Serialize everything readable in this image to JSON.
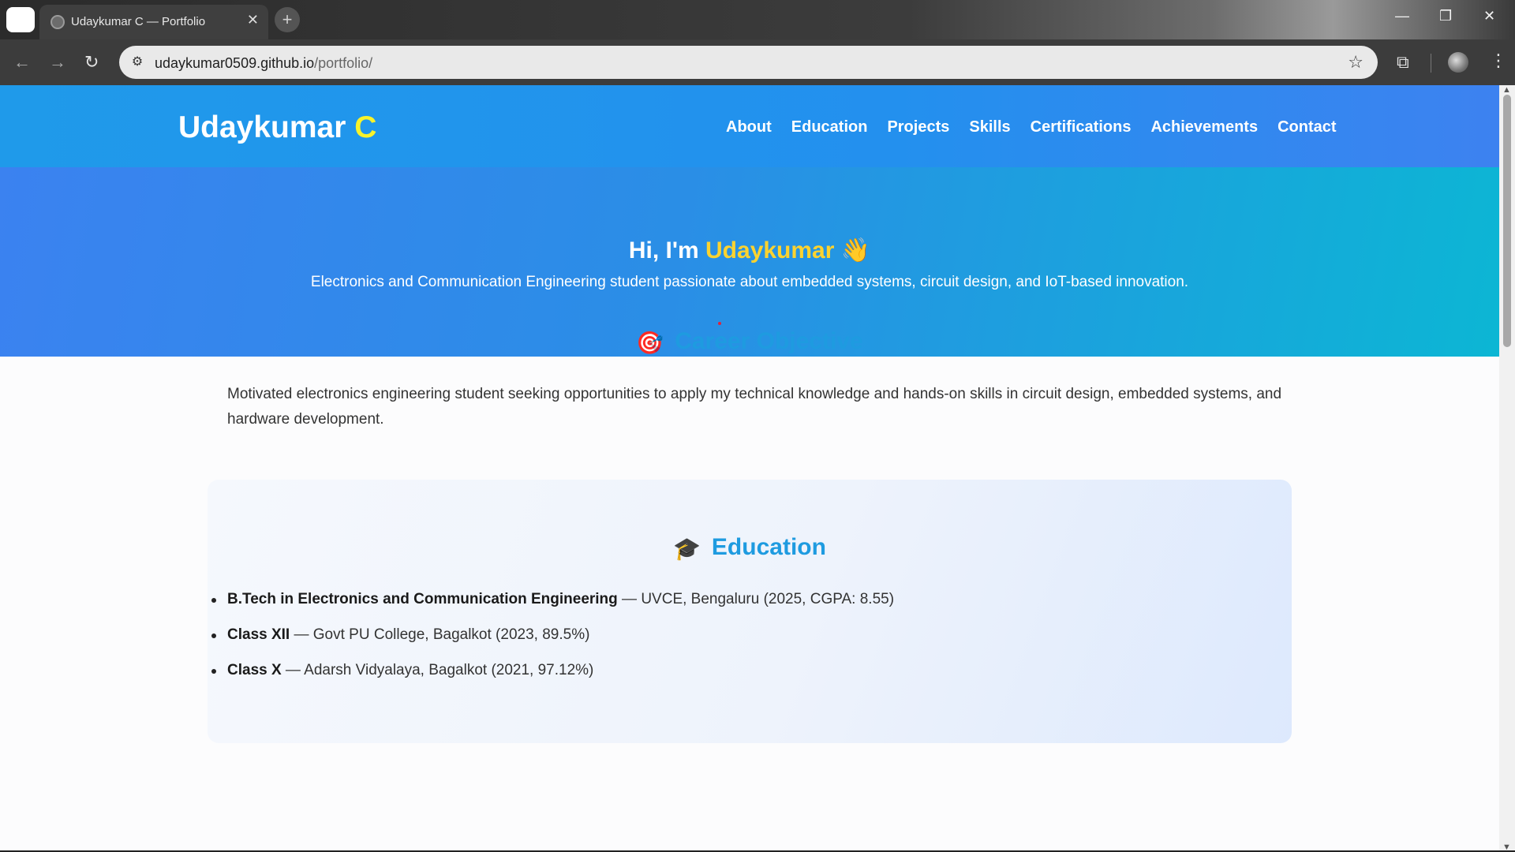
{
  "browser": {
    "tab_title": "Udaykumar C — Portfolio",
    "tab_close": "✕",
    "new_tab": "+",
    "url_host": "udaykumar0509.github.io",
    "url_path": "/portfolio/",
    "controls": {
      "minimize": "—",
      "maximize": "❐",
      "close": "✕"
    },
    "nav": {
      "back": "←",
      "forward": "→",
      "reload": "↻"
    },
    "icons": {
      "star": "☆",
      "tune": "⚙",
      "extensions": "⧉",
      "menu": "⋮"
    }
  },
  "site": {
    "brand": {
      "name": "Udaykumar ",
      "accent": "C",
      "accent_color": "#f8f32b"
    },
    "menu": [
      "About",
      "Education",
      "Projects",
      "Skills",
      "Certifications",
      "Achievements",
      "Contact"
    ],
    "hero": {
      "greeting": "Hi, I'm ",
      "name": "Udaykumar",
      "wave": "👋",
      "tagline": "Electronics and Communication Engineering student passionate about embedded systems, circuit design, and IoT-based innovation."
    },
    "objective": {
      "emoji": "🎯",
      "title": "Career Objective",
      "text": "Motivated electronics engineering student seeking opportunities to apply my technical knowledge and hands-on skills in circuit design, embedded systems, and hardware development."
    },
    "education": {
      "emoji": "🎓",
      "title": "Education",
      "items": [
        {
          "degree": "B.Tech in Electronics and Communication Engineering",
          "detail": " — UVCE, Bengaluru (2025, CGPA: 8.55)"
        },
        {
          "degree": "Class XII",
          "detail": " — Govt PU College, Bagalkot (2023, 89.5%)"
        },
        {
          "degree": "Class X",
          "detail": " — Adarsh Vidyalaya, Bagalkot (2021, 97.12%)"
        }
      ]
    },
    "colors": {
      "header": "#1f9aea",
      "title": "#1e9be0",
      "name_highlight": "#fcd32f"
    }
  }
}
